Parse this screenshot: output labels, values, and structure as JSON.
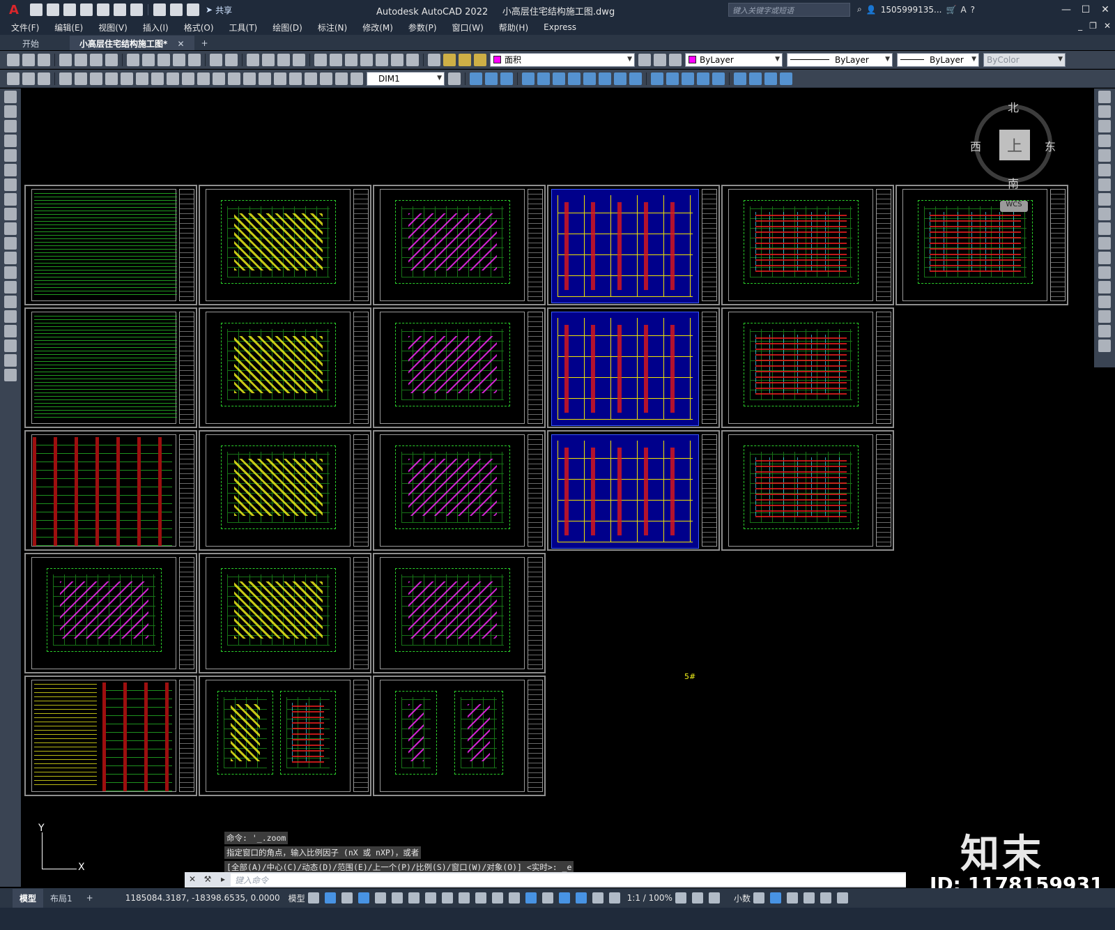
{
  "app": {
    "title": "Autodesk AutoCAD 2022",
    "file_title": "小高层住宅结构施工图.dwg",
    "logo_letter": "A",
    "share_label": "共享",
    "search_placeholder": "键入关键字或短语",
    "user": "1505999135...",
    "help": "?"
  },
  "menu": {
    "items": [
      "文件(F)",
      "编辑(E)",
      "视图(V)",
      "插入(I)",
      "格式(O)",
      "工具(T)",
      "绘图(D)",
      "标注(N)",
      "修改(M)",
      "参数(P)",
      "窗口(W)",
      "帮助(H)",
      "Express"
    ]
  },
  "tabs": {
    "start": "开始",
    "active": "小高层住宅结构施工图*",
    "add": "+"
  },
  "toolbar": {
    "layer": "面积",
    "color": "ByLayer",
    "linetype": "ByLayer",
    "lineweight": "ByLayer",
    "plotstyle": "ByColor",
    "dimstyle": "DIM1"
  },
  "viewcube": {
    "north": "北",
    "south": "南",
    "east": "东",
    "west": "西",
    "top": "上",
    "wcs": "WCS"
  },
  "canvas": {
    "label": "5#"
  },
  "ucs": {
    "x": "X",
    "y": "Y"
  },
  "command": {
    "history": [
      "命令: '_.zoom",
      "指定窗口的角点，输入比例因子 (nX 或 nXP)，或者",
      "[全部(A)/中心(C)/动态(D)/范围(E)/上一个(P)/比例(S)/窗口(W)/对象(O)] <实时>: _e"
    ],
    "placeholder": "键入命令"
  },
  "status": {
    "model_tab": "模型",
    "layout_tab": "布局1",
    "add_tab": "+",
    "coords": "1185084.3187, -18398.6535, 0.0000",
    "model_label": "模型",
    "scale": "1:1 / 100%",
    "units": "小数"
  },
  "watermark": {
    "brand": "知末",
    "id": "ID: 1178159931"
  }
}
